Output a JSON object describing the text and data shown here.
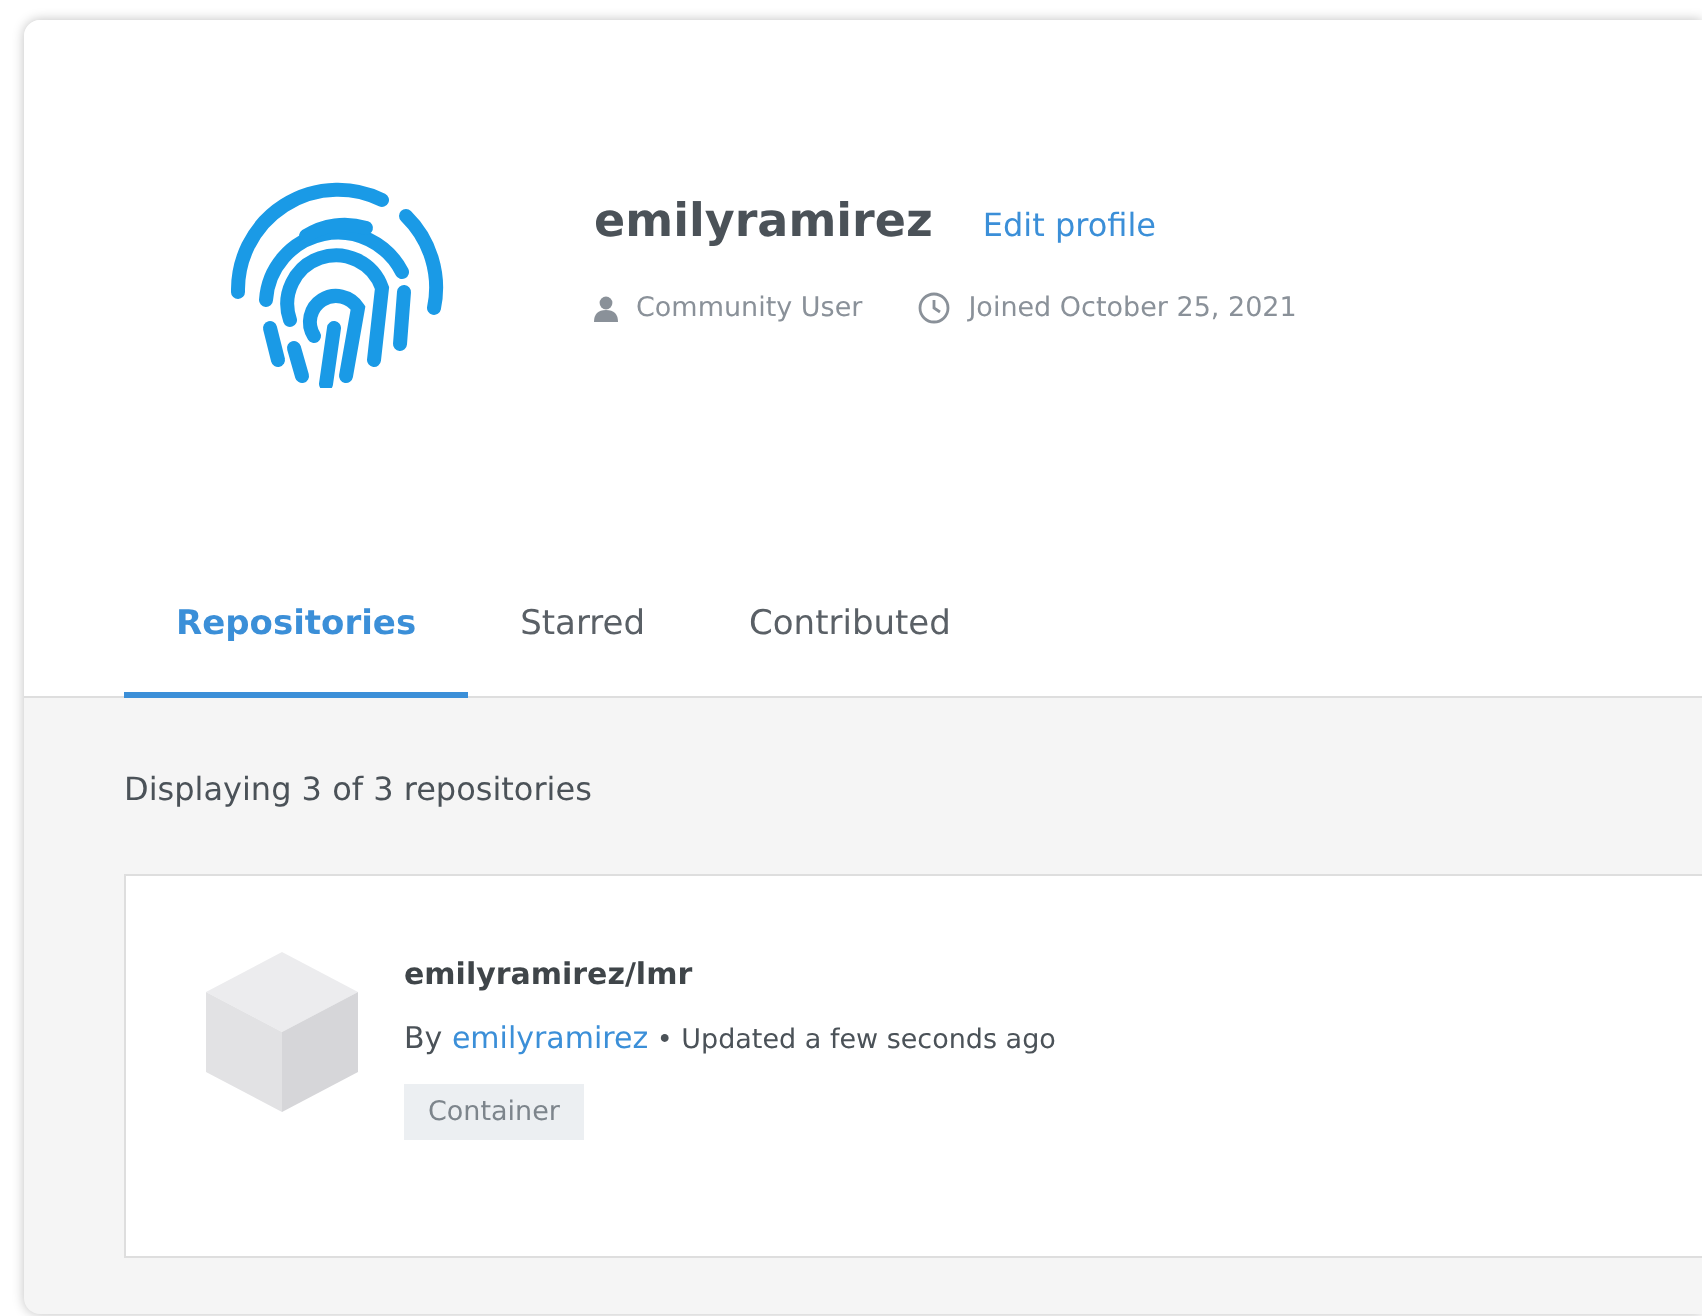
{
  "profile": {
    "username": "emilyramirez",
    "edit_link": "Edit profile",
    "role": "Community User",
    "joined": "Joined October 25, 2021"
  },
  "tabs": [
    {
      "label": "Repositories",
      "selected": true
    },
    {
      "label": "Starred",
      "selected": false
    },
    {
      "label": "Contributed",
      "selected": false
    }
  ],
  "summary": "Displaying 3 of 3 repositories",
  "repositories": [
    {
      "name": "emilyramirez/lmr",
      "by": "By",
      "author": "emilyramirez",
      "separator": "•",
      "updated": "Updated a few seconds ago",
      "tag": "Container"
    }
  ]
}
